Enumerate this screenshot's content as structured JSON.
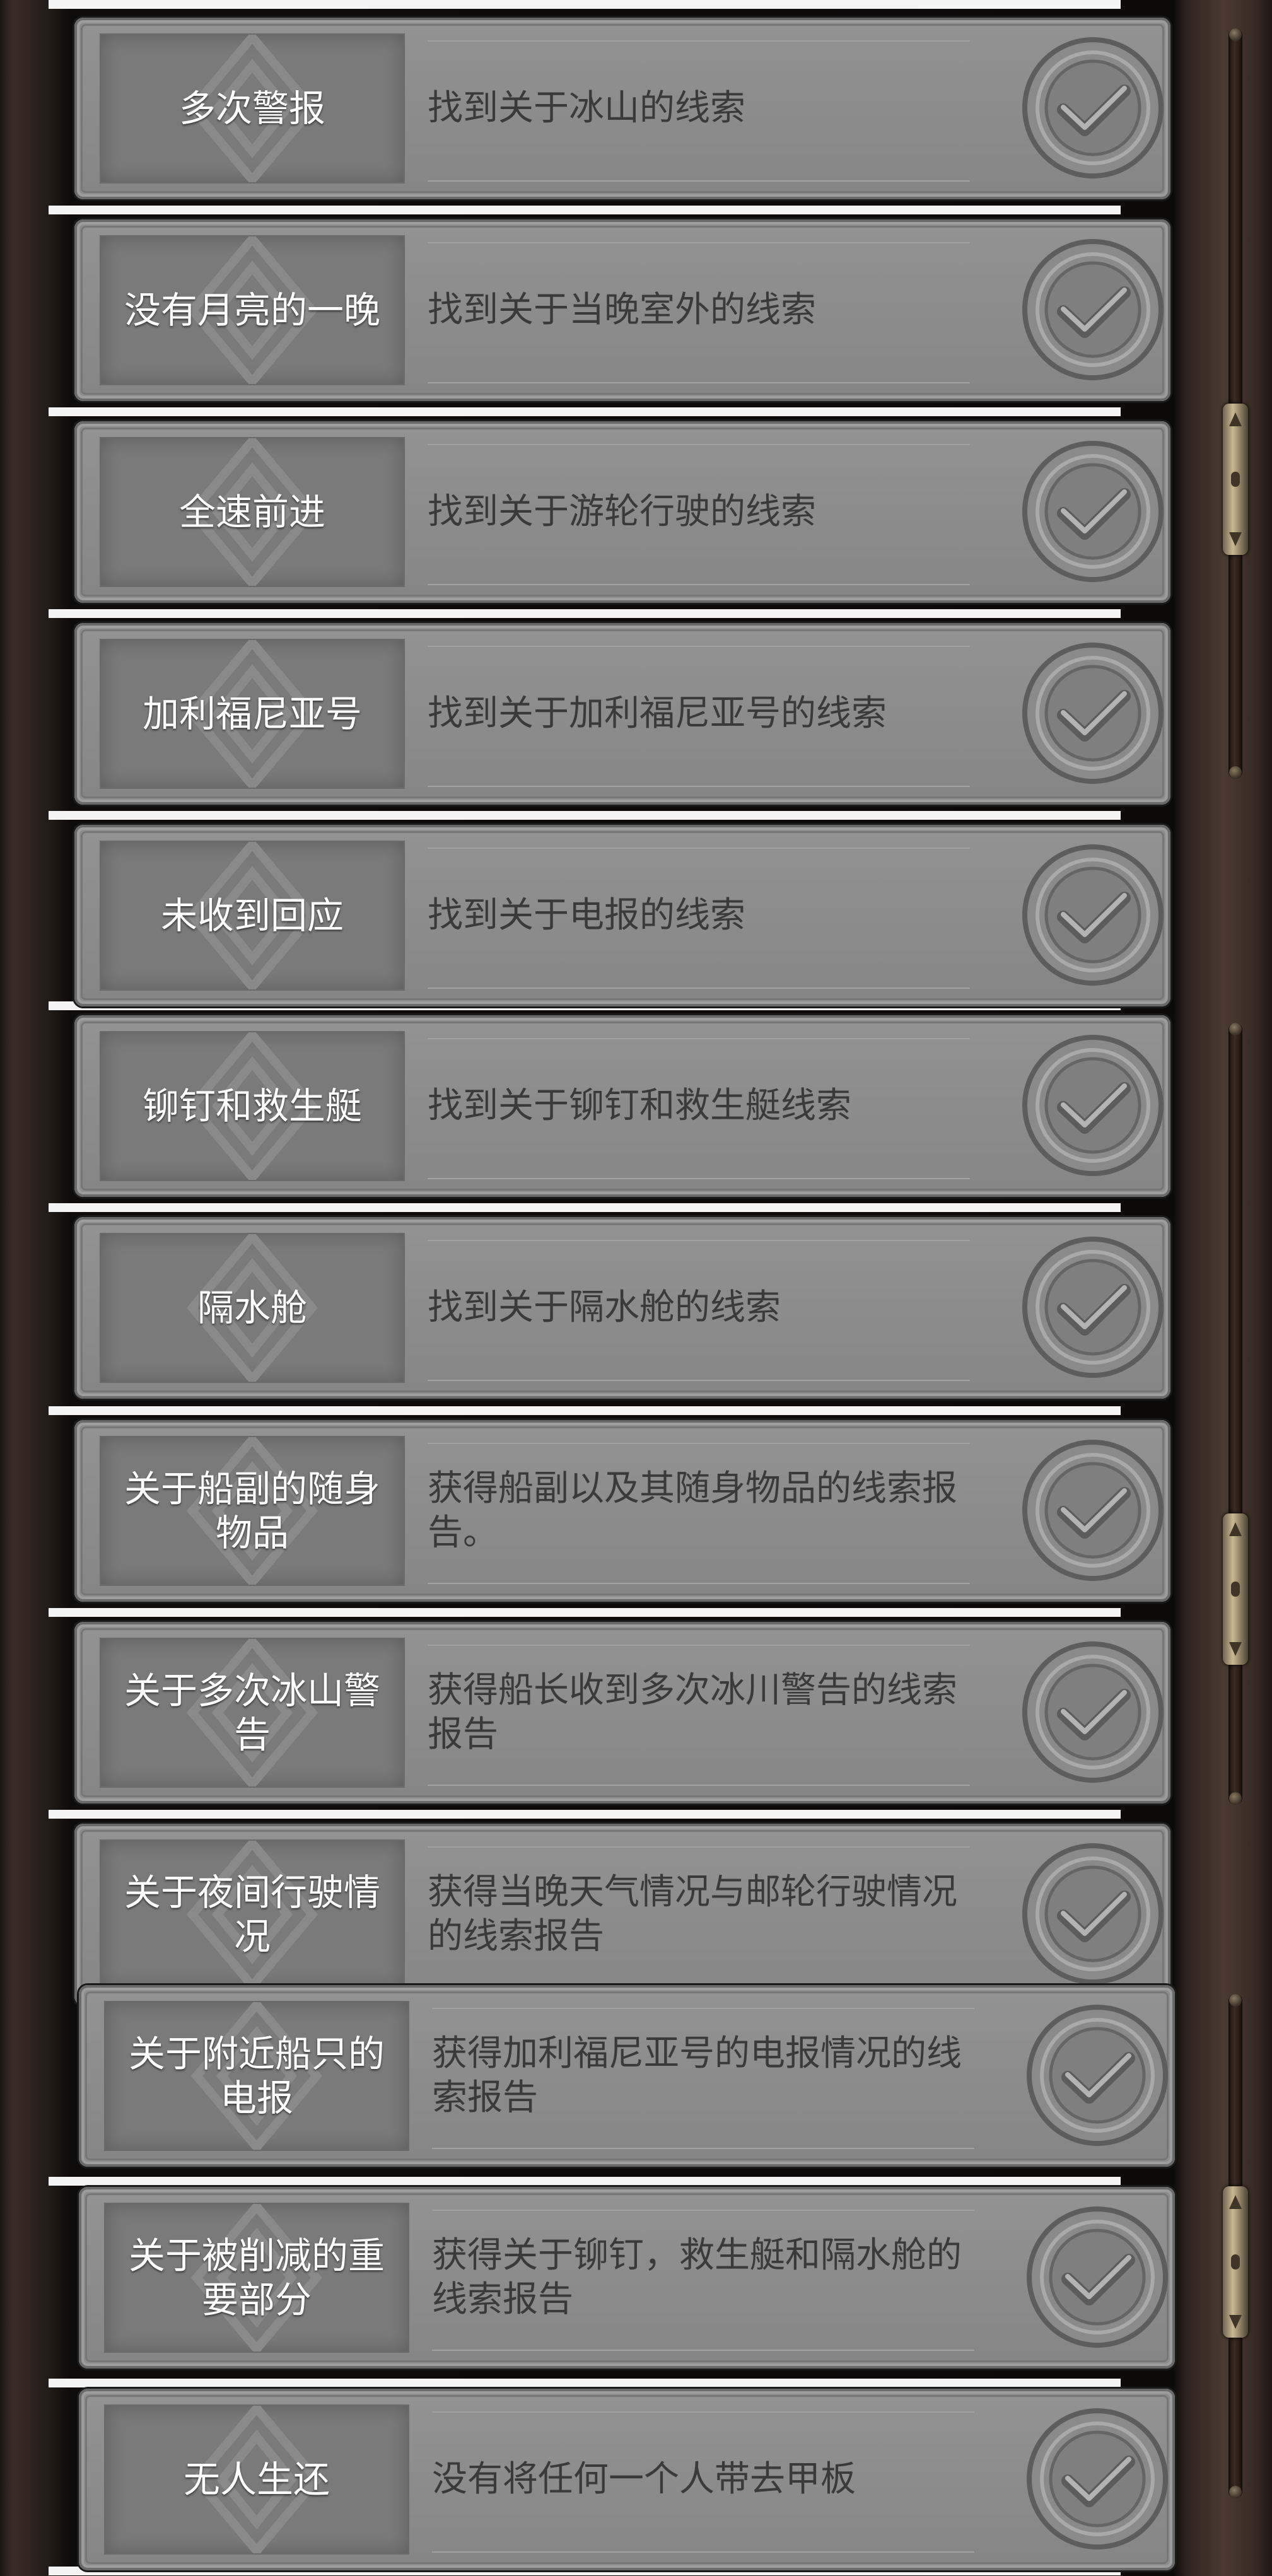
{
  "achievements": [
    {
      "title": "多次警报",
      "description": "找到关于冰山的线索"
    },
    {
      "title": "没有月亮的一晚",
      "description": "找到关于当晚室外的线索"
    },
    {
      "title": "全速前进",
      "description": "找到关于游轮行驶的线索"
    },
    {
      "title": "加利福尼亚号",
      "description": "找到关于加利福尼亚号的线索"
    },
    {
      "title": "未收到回应",
      "description": "找到关于电报的线索"
    },
    {
      "title": "铆钉和救生艇",
      "description": "找到关于铆钉和救生艇线索"
    },
    {
      "title": "隔水舱",
      "description": "找到关于隔水舱的线索"
    },
    {
      "title": "关于船副的随身物品",
      "description": "获得船副以及其随身物品的线索报告。"
    },
    {
      "title": "关于多次冰山警告",
      "description": "获得船长收到多次冰川警告的线索报告"
    },
    {
      "title": "关于夜间行驶情况",
      "description": "获得当晚天气情况与邮轮行驶情况的线索报告"
    },
    {
      "title": "关于附近船只的电报",
      "description": "获得加利福尼亚号的电报情况的线索报告"
    },
    {
      "title": "关于被削减的重要部分",
      "description": "获得关于铆钉，救生艇和隔水舱的线索报告"
    },
    {
      "title": "无人生还",
      "description": "没有将任何一个人带去甲板"
    }
  ],
  "icons": {
    "status": "checkmark-icon",
    "scroll": "scrollbar-thumb"
  },
  "colors": {
    "card": "#8d8d8d",
    "title_box": "#7a7a7a",
    "title_text": "#ffffff",
    "desc_text": "#3a3a3a"
  }
}
